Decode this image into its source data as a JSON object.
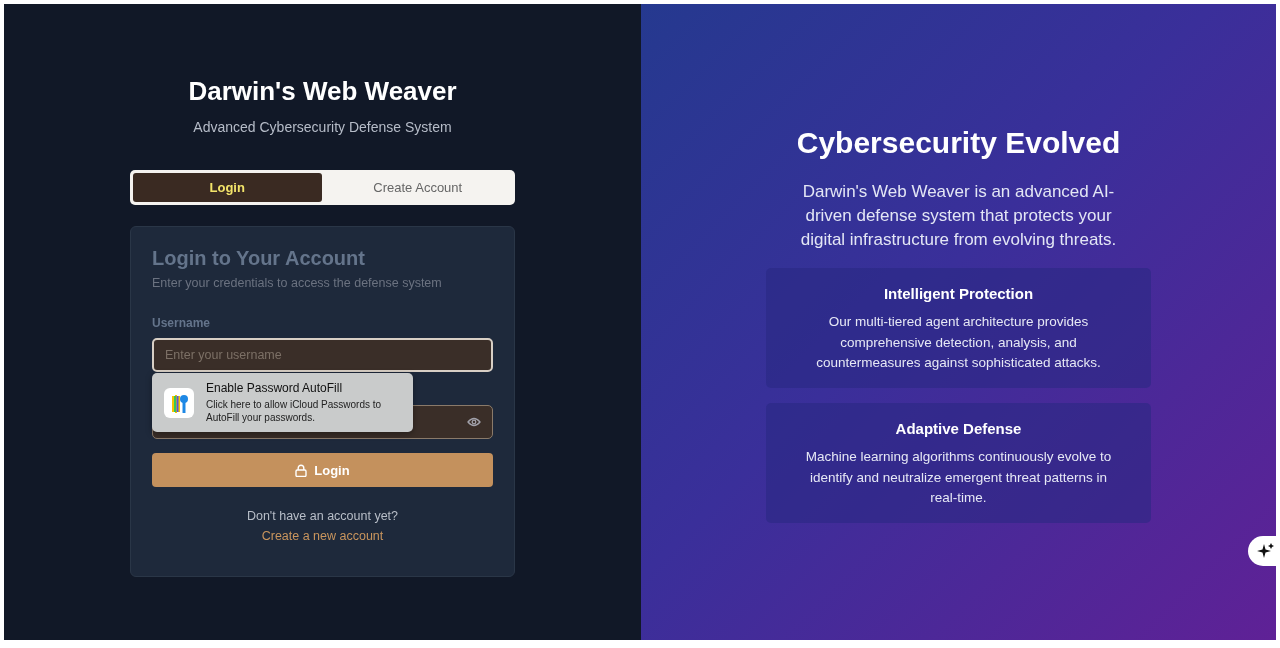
{
  "brand": {
    "title": "Darwin's Web Weaver",
    "subtitle": "Advanced Cybersecurity Defense System"
  },
  "tabs": [
    {
      "label": "Login",
      "selected": true
    },
    {
      "label": "Create Account",
      "selected": false
    }
  ],
  "login_card": {
    "title": "Login to Your Account",
    "description": "Enter your credentials to access the defense system",
    "username": {
      "label": "Username",
      "placeholder": "Enter your username"
    },
    "submit": "Login",
    "prompt": "Don't have an account yet?",
    "link": "Create a new account"
  },
  "autofill_popup": {
    "title": "Enable Password AutoFill",
    "text": "Click here to allow iCloud Passwords to AutoFill your passwords."
  },
  "hero": {
    "title": "Cybersecurity Evolved",
    "text": "Darwin's Web Weaver is an advanced AI-driven defense system that protects your digital infrastructure from evolving threats.",
    "features": [
      {
        "title": "Intelligent Protection",
        "text": "Our multi-tiered agent architecture provides comprehensive detection, analysis, and countermeasures against sophisticated attacks."
      },
      {
        "title": "Adaptive Defense",
        "text": "Machine learning algorithms continuously evolve to identify and neutralize emergent threat patterns in real-time."
      }
    ]
  }
}
